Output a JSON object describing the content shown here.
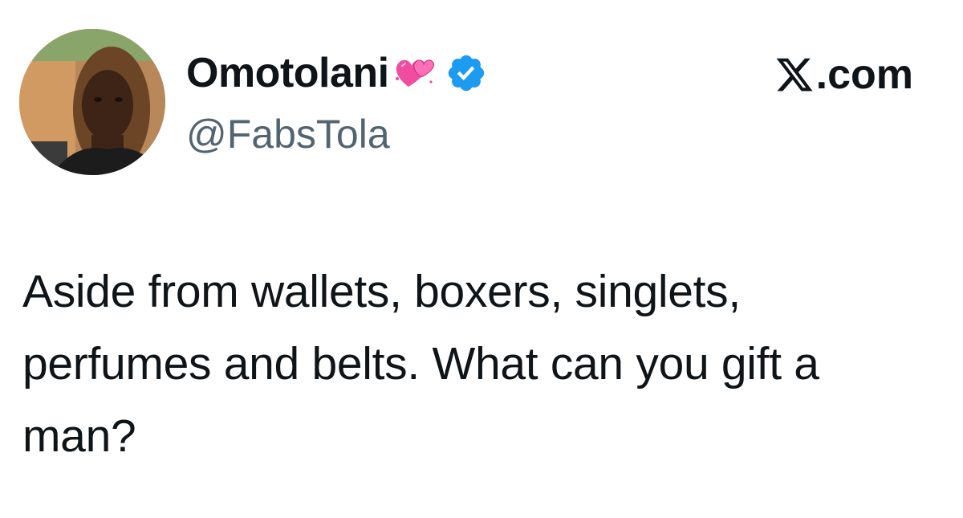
{
  "tweet": {
    "author": {
      "display_name": "Omotolani",
      "emoji": "pink-hearts-emoji",
      "verified": true,
      "handle": "@FabsTola",
      "avatar": "profile-photo"
    },
    "site_label": ".com",
    "site_logo": "x-logo-icon",
    "text_lines": [
      "Aside from wallets, boxers, singlets,",
      "perfumes and belts. What can you gift a",
      "man?"
    ]
  },
  "colors": {
    "text": "#0f1419",
    "handle": "#536471",
    "verified": "#1d9bf0",
    "heart": "#f04ca0"
  }
}
